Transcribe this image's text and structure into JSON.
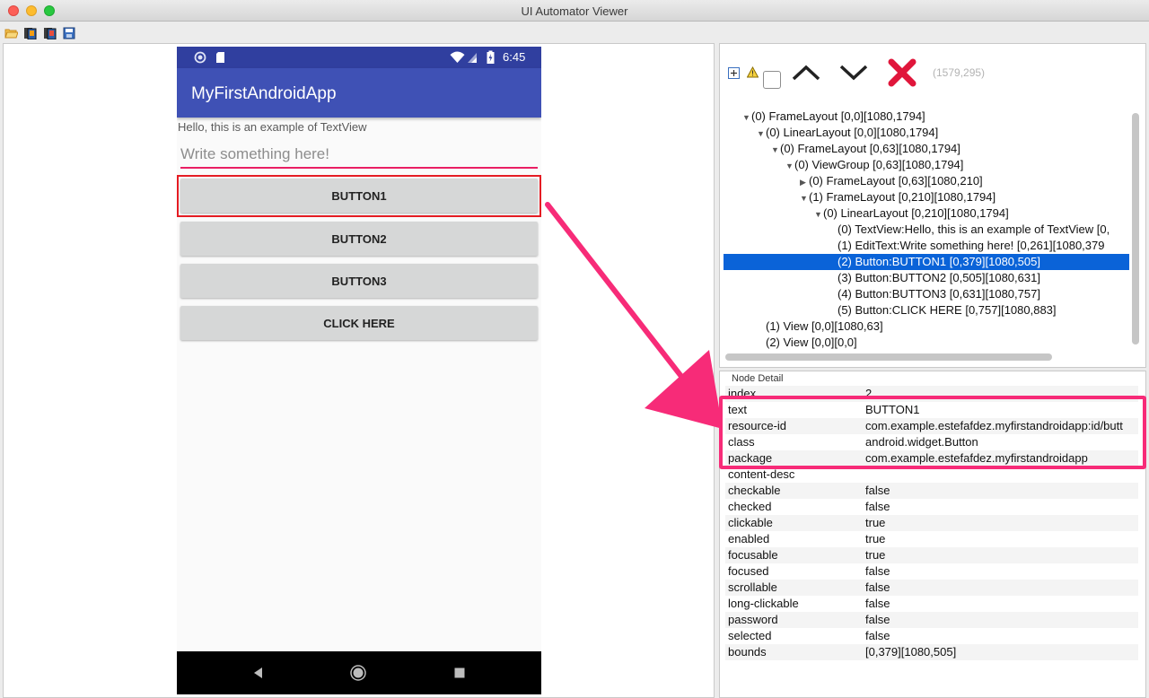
{
  "window": {
    "title": "UI Automator Viewer"
  },
  "toolbar": {
    "icons": [
      "open-folder-icon",
      "device-screenshot-icon",
      "device-screenshot-compressed-icon",
      "save-icon"
    ]
  },
  "device": {
    "status_time": "6:45",
    "app_title": "MyFirstAndroidApp",
    "textview": "Hello, this is an example of TextView",
    "edittext_hint": "Write something here!",
    "buttons": [
      "BUTTON1",
      "BUTTON2",
      "BUTTON3",
      "CLICK HERE"
    ]
  },
  "tree_toolbar": {
    "icons": [
      "expand-all-icon",
      "warning-icon",
      "checkbox",
      "chevron-up-icon",
      "chevron-down-icon",
      "red-x-icon"
    ],
    "coordinates": "(1579,295)"
  },
  "tree": [
    {
      "indent": 1,
      "toggle": "▼",
      "label": "(0) FrameLayout [0,0][1080,1794]"
    },
    {
      "indent": 2,
      "toggle": "▼",
      "label": "(0) LinearLayout [0,0][1080,1794]"
    },
    {
      "indent": 3,
      "toggle": "▼",
      "label": "(0) FrameLayout [0,63][1080,1794]"
    },
    {
      "indent": 4,
      "toggle": "▼",
      "label": "(0) ViewGroup [0,63][1080,1794]"
    },
    {
      "indent": 5,
      "toggle": "▶",
      "label": "(0) FrameLayout [0,63][1080,210]"
    },
    {
      "indent": 5,
      "toggle": "▼",
      "label": "(1) FrameLayout [0,210][1080,1794]"
    },
    {
      "indent": 6,
      "toggle": "▼",
      "label": "(0) LinearLayout [0,210][1080,1794]"
    },
    {
      "indent": 7,
      "toggle": "",
      "label": "(0) TextView:Hello, this is an example of TextView [0,"
    },
    {
      "indent": 7,
      "toggle": "",
      "label": "(1) EditText:Write something here! [0,261][1080,379"
    },
    {
      "indent": 7,
      "toggle": "",
      "label": "(2) Button:BUTTON1 [0,379][1080,505]",
      "selected": true
    },
    {
      "indent": 7,
      "toggle": "",
      "label": "(3) Button:BUTTON2 [0,505][1080,631]"
    },
    {
      "indent": 7,
      "toggle": "",
      "label": "(4) Button:BUTTON3 [0,631][1080,757]"
    },
    {
      "indent": 7,
      "toggle": "",
      "label": "(5) Button:CLICK HERE [0,757][1080,883]"
    },
    {
      "indent": 2,
      "toggle": "",
      "label": "(1) View [0,0][1080,63]"
    },
    {
      "indent": 2,
      "toggle": "",
      "label": "(2) View [0,0][0,0]"
    }
  ],
  "node_detail": {
    "title": "Node Detail",
    "rows": [
      {
        "key": "index",
        "value": "2"
      },
      {
        "key": "text",
        "value": "BUTTON1"
      },
      {
        "key": "resource-id",
        "value": "com.example.estefafdez.myfirstandroidapp:id/butt"
      },
      {
        "key": "class",
        "value": "android.widget.Button"
      },
      {
        "key": "package",
        "value": "com.example.estefafdez.myfirstandroidapp"
      },
      {
        "key": "content-desc",
        "value": ""
      },
      {
        "key": "checkable",
        "value": "false"
      },
      {
        "key": "checked",
        "value": "false"
      },
      {
        "key": "clickable",
        "value": "true"
      },
      {
        "key": "enabled",
        "value": "true"
      },
      {
        "key": "focusable",
        "value": "true"
      },
      {
        "key": "focused",
        "value": "false"
      },
      {
        "key": "scrollable",
        "value": "false"
      },
      {
        "key": "long-clickable",
        "value": "false"
      },
      {
        "key": "password",
        "value": "false"
      },
      {
        "key": "selected",
        "value": "false"
      },
      {
        "key": "bounds",
        "value": "[0,379][1080,505]"
      }
    ]
  },
  "colors": {
    "accent_pink": "#f72b78",
    "selection_blue": "#0a63d8",
    "app_bar": "#3f51b5",
    "status_bar": "#303f9f"
  }
}
